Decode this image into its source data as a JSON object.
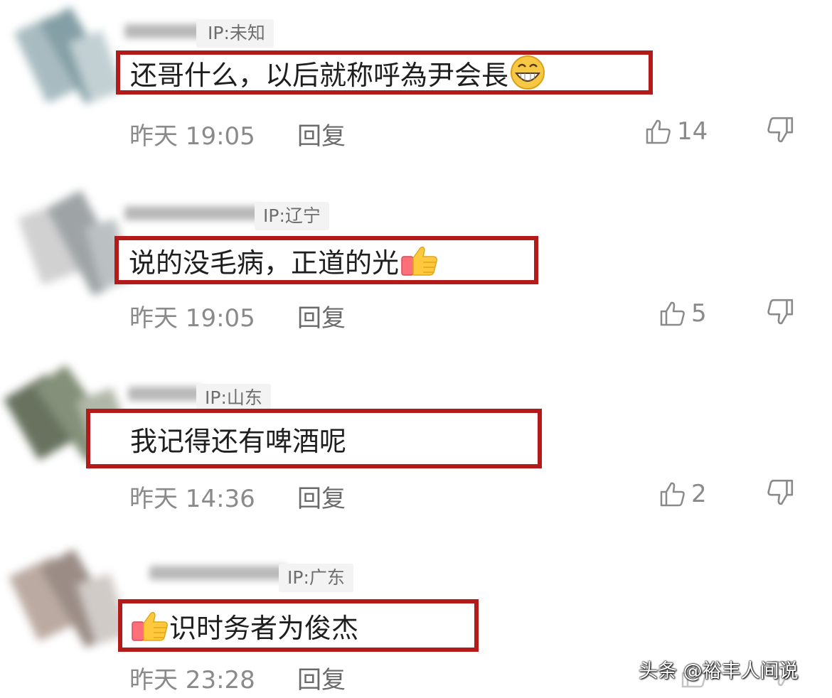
{
  "comments": [
    {
      "ip": "IP:未知",
      "text": "还哥什么，以后就称呼為尹会長",
      "emoji": "grinning-face",
      "emoji_position": "after",
      "time": "昨天 19:05",
      "reply": "回复",
      "likes": "14"
    },
    {
      "ip": "IP:辽宁",
      "text": "说的没毛病，正道的光",
      "emoji": "thumbs-up",
      "emoji_position": "after",
      "time": "昨天 19:05",
      "reply": "回复",
      "likes": "5"
    },
    {
      "ip": "IP:山东",
      "text": "我记得还有啤酒呢",
      "emoji": "",
      "emoji_position": "",
      "time": "昨天 14:36",
      "reply": "回复",
      "likes": "2"
    },
    {
      "ip": "IP:广东",
      "text": "识时务者为俊杰",
      "emoji": "thumbs-up",
      "emoji_position": "before",
      "time": "昨天 23:28",
      "reply": "回复",
      "likes": ""
    }
  ],
  "watermark": "头条 @裕丰人间说",
  "colors": {
    "highlight_border": "#b31b1b",
    "meta_text": "#8a8a8a",
    "ip_tag_bg": "#f3f3f3"
  }
}
